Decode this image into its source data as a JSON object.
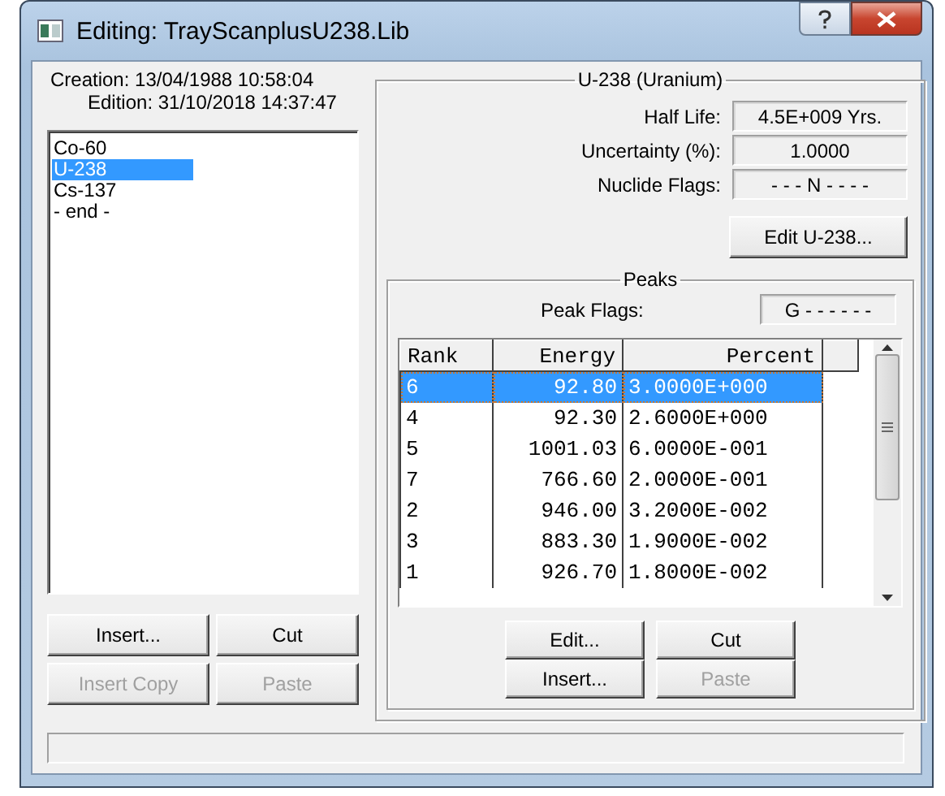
{
  "window": {
    "title": "Editing: TrayScanplusU238.Lib"
  },
  "library": {
    "creation": "Creation: 13/04/1988  10:58:04",
    "edition": "Edition: 31/10/2018  14:37:47",
    "nuclides": [
      {
        "name": "Co-60",
        "selected": false
      },
      {
        "name": "U-238",
        "selected": true
      },
      {
        "name": "Cs-137",
        "selected": false
      },
      {
        "name": "- end -",
        "selected": false
      }
    ],
    "buttons": [
      {
        "label": "Insert...",
        "disabled": false
      },
      {
        "label": "Cut",
        "disabled": false
      },
      {
        "label": "Insert Copy",
        "disabled": true
      },
      {
        "label": "Paste",
        "disabled": true
      }
    ]
  },
  "nuclide": {
    "title": "U-238 (Uranium)",
    "fields": [
      {
        "label": "Half Life:",
        "value": "4.5E+009 Yrs."
      },
      {
        "label": "Uncertainty (%):",
        "value": "1.0000"
      },
      {
        "label": "Nuclide Flags:",
        "value": "- - - N - - - -"
      }
    ],
    "edit_button": "Edit U-238...",
    "peaks": {
      "title": "Peaks",
      "flags_label": "Peak Flags:",
      "flags": "G - - - - - -",
      "columns": [
        "Rank",
        "Energy",
        "Percent"
      ],
      "rows": [
        {
          "cells": [
            "6",
            "92.80",
            "3.0000E+000"
          ],
          "selected": true
        },
        {
          "cells": [
            "4",
            "92.30",
            "2.6000E+000"
          ],
          "selected": false
        },
        {
          "cells": [
            "5",
            "1001.03",
            "6.0000E-001"
          ],
          "selected": false
        },
        {
          "cells": [
            "7",
            "766.60",
            "2.0000E-001"
          ],
          "selected": false
        },
        {
          "cells": [
            "2",
            "946.00",
            "3.2000E-002"
          ],
          "selected": false
        },
        {
          "cells": [
            "3",
            "883.30",
            "1.9000E-002"
          ],
          "selected": false
        },
        {
          "cells": [
            "1",
            "926.70",
            "1.8000E-002"
          ],
          "selected": false
        }
      ],
      "buttons": [
        {
          "label": "Edit...",
          "disabled": false
        },
        {
          "label": "Cut",
          "disabled": false
        },
        {
          "label": "Insert...",
          "disabled": false
        },
        {
          "label": "Paste",
          "disabled": true
        }
      ]
    }
  }
}
